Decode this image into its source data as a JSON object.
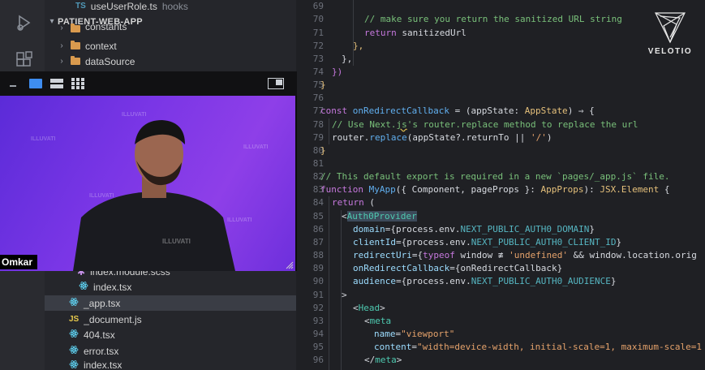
{
  "sidebar": {
    "top_file": {
      "badge": "TS",
      "name": "useUserRole.ts",
      "hint": "hooks"
    },
    "project_title": "PATIENT-WEB-APP",
    "folders": [
      {
        "name": "constants"
      },
      {
        "name": "context"
      },
      {
        "name": "dataSource"
      }
    ],
    "partial_file": "index.module.scss",
    "files": [
      {
        "badge": "react",
        "name": "index.tsx",
        "selected": false
      },
      {
        "badge": "react",
        "name": "_app.tsx",
        "selected": true
      },
      {
        "badge": "JS",
        "name": "_document.js",
        "selected": false
      },
      {
        "badge": "react",
        "name": "404.tsx",
        "selected": false
      },
      {
        "badge": "react",
        "name": "error.tsx",
        "selected": false
      },
      {
        "badge": "react",
        "name": "index.tsx",
        "selected": false
      }
    ]
  },
  "video": {
    "participant_name": "Omkar",
    "watermark": "ILLUVATI"
  },
  "logo": {
    "text": "VELOTIO"
  },
  "editor": {
    "line_numbers": [
      "69",
      "70",
      "71",
      "72",
      "73",
      "74",
      "75",
      "76",
      "77",
      "78",
      "79",
      "80",
      "81",
      "82",
      "83",
      "84",
      "85",
      "86",
      "87",
      "88",
      "89",
      "90",
      "91",
      "92",
      "93",
      "94",
      "95",
      "96"
    ],
    "lines": {
      "l70": "// make sure you return the sanitized URL string",
      "l71_kw": "return",
      "l71_v": "sanitizedUrl",
      "l72": "},",
      "l73": "},",
      "l74": "})",
      "l75": "}",
      "l77_kw": "const",
      "l77_fn": "onRedirectCallback",
      "l77_a": " = (",
      "l77_p": "appState",
      "l77_b": ": ",
      "l77_ty": "AppState",
      "l77_c": ") ⇒ {",
      "l78_a": "// Use Next.",
      "l78_sq": "js",
      "l78_b": "'s router.replace method to replace the url",
      "l79_a": "router.",
      "l79_fn": "replace",
      "l79_b": "(appState?.returnTo || ",
      "l79_st": "'/'",
      "l79_c": ")",
      "l80": "}",
      "l82": "// This default export is required in a new `pages/_app.js` file.",
      "l83_kw": "function",
      "l83_fn": "MyApp",
      "l83_a": "({ Component, pageProps }: ",
      "l83_ty": "AppProps",
      "l83_b": "): ",
      "l83_ty2": "JSX.Element",
      "l83_c": " {",
      "l84_kw": "return",
      "l84_a": " (",
      "l85_a": "<",
      "l85_tg": "Auth0Provider",
      "l86_at": "domain",
      "l86_a": "={process.env.",
      "l86_env": "NEXT_PUBLIC_AUTH0_DOMAIN",
      "l86_b": "}",
      "l87_at": "clientId",
      "l87_a": "={process.env.",
      "l87_env": "NEXT_PUBLIC_AUTH0_CLIENT_ID",
      "l87_b": "}",
      "l88_at": "redirectUri",
      "l88_a": "={",
      "l88_kw": "typeof",
      "l88_b": " window ≢ ",
      "l88_st": "'undefined'",
      "l88_c": " && window.location.orig",
      "l89_at": "onRedirectCallback",
      "l89_a": "={onRedirectCallback}",
      "l90_at": "audience",
      "l90_a": "={process.env.",
      "l90_env": "NEXT_PUBLIC_AUTH0_AUDIENCE",
      "l90_b": "}",
      "l91": ">",
      "l92_a": "<",
      "l92_tg": "Head",
      "l92_b": ">",
      "l93_a": "<",
      "l93_tg": "meta",
      "l94_at": "name",
      "l94_a": "=",
      "l94_st": "\"viewport\"",
      "l95_at": "content",
      "l95_a": "=",
      "l95_st": "\"width=device-width, initial-scale=1, maximum-scale=1",
      "l96_a": "</",
      "l96_tg": "meta",
      "l96_b": ">"
    }
  }
}
